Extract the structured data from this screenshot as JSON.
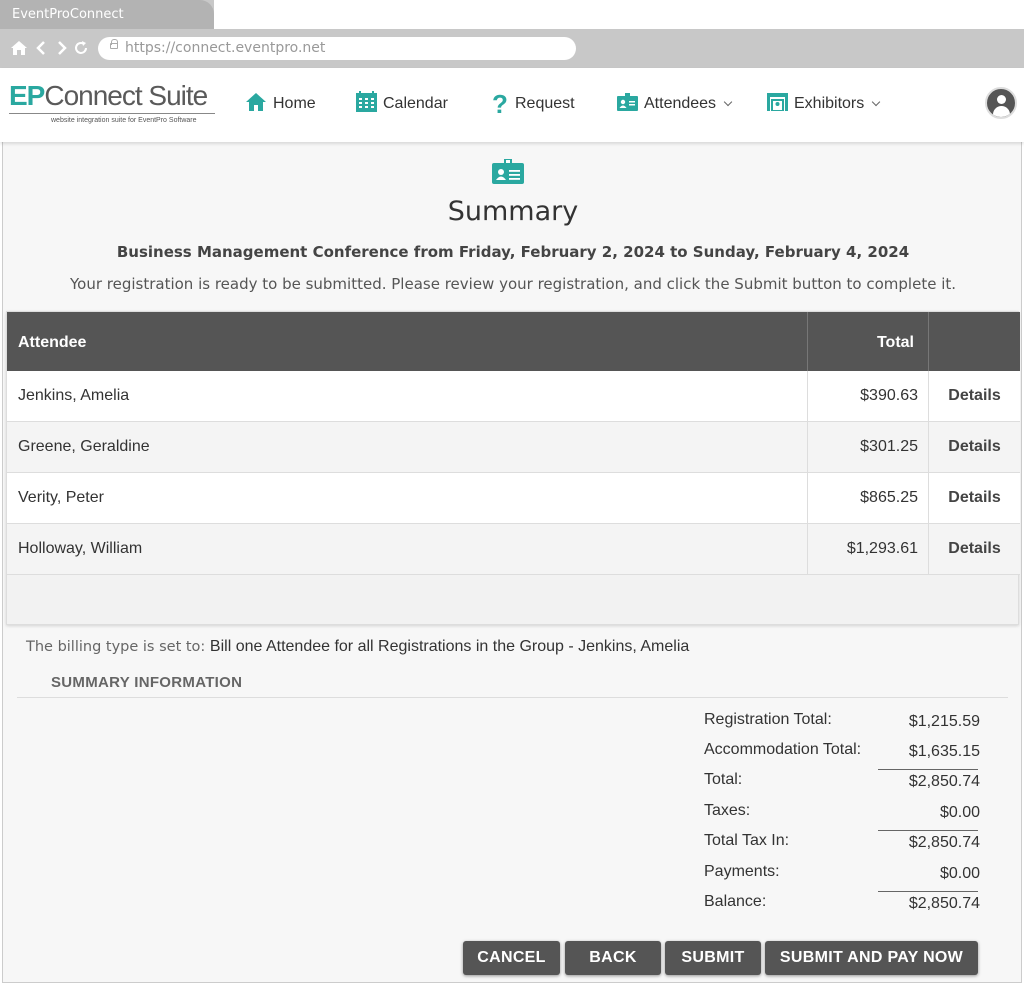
{
  "browser": {
    "tab_title": "EventProConnect",
    "url": "https://connect.eventpro.net"
  },
  "header": {
    "logo": {
      "ep": "EP",
      "connect_suite": "Connect Suite",
      "tagline": "website integration suite for EventPro Software"
    },
    "nav": [
      {
        "label": "Home",
        "icon": "house-icon"
      },
      {
        "label": "Calendar",
        "icon": "calendar-icon"
      },
      {
        "label": "Request",
        "icon": "question-mark-icon"
      },
      {
        "label": "Attendees",
        "icon": "id-badge-icon",
        "dropdown": true
      },
      {
        "label": "Exhibitors",
        "icon": "booth-icon",
        "dropdown": true
      }
    ],
    "accent_color": "#2aa8a0"
  },
  "page": {
    "icon": "id-badge-icon",
    "title": "Summary",
    "event_line": "Business Management Conference from Friday, February 2, 2024 to Sunday, February 4, 2024",
    "intro": "Your registration is ready to be submitted. Please review your registration, and click the Submit button to complete it."
  },
  "table": {
    "headers": {
      "attendee": "Attendee",
      "total": "Total"
    },
    "rows": [
      {
        "name": "Jenkins, Amelia",
        "total": "$390.63",
        "action": "Details"
      },
      {
        "name": "Greene, Geraldine",
        "total": "$301.25",
        "action": "Details"
      },
      {
        "name": "Verity, Peter",
        "total": "$865.25",
        "action": "Details"
      },
      {
        "name": "Holloway, William",
        "total": "$1,293.61",
        "action": "Details"
      }
    ]
  },
  "billing": {
    "label": "The billing type is set to: ",
    "value": "Bill one Attendee for all Registrations in the Group - Jenkins, Amelia"
  },
  "summary": {
    "heading": "SUMMARY INFORMATION",
    "rows": [
      {
        "label": "Registration Total:",
        "value": "$1,215.59",
        "rule": false
      },
      {
        "label": "Accommodation Total:",
        "value": "$1,635.15",
        "rule": false
      },
      {
        "label": "Total:",
        "value": "$2,850.74",
        "rule": true
      },
      {
        "label": "Taxes:",
        "value": "$0.00",
        "rule": false
      },
      {
        "label": "Total Tax In:",
        "value": "$2,850.74",
        "rule": true
      },
      {
        "label": "Payments:",
        "value": "$0.00",
        "rule": false
      },
      {
        "label": "Balance:",
        "value": "$2,850.74",
        "rule": true
      }
    ]
  },
  "buttons": {
    "cancel": "CANCEL",
    "back": "BACK",
    "submit": "SUBMIT",
    "submit_pay": "SUBMIT AND PAY NOW"
  }
}
